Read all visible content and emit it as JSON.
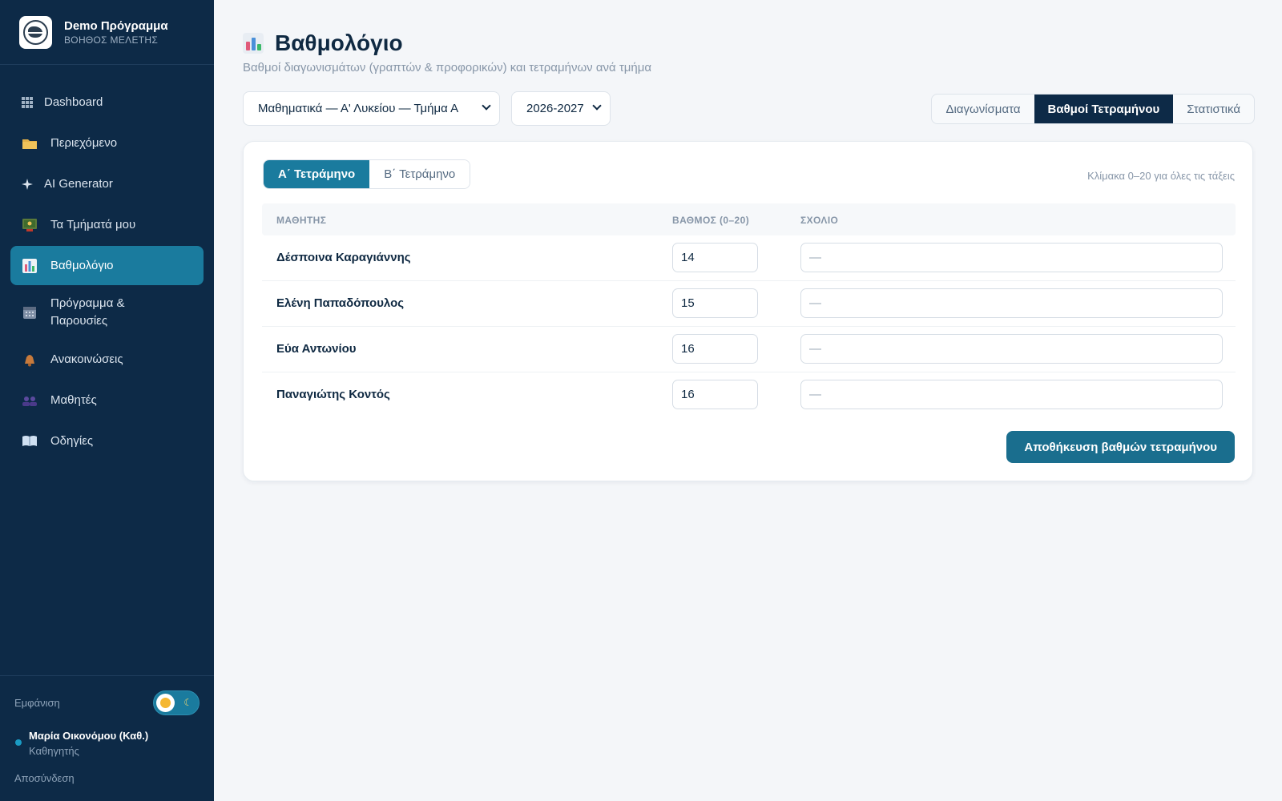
{
  "brand": {
    "title": "Demo Πρόγραμμα",
    "subtitle": "ΒΟΗΘΟΣ ΜΕΛΕΤΗΣ"
  },
  "sidebar": {
    "items": [
      {
        "label": "Dashboard",
        "icon": "grid-icon"
      },
      {
        "label": "Περιεχόμενο",
        "icon": "folder-icon"
      },
      {
        "label": "AI Generator",
        "icon": "sparkle-icon"
      },
      {
        "label": "Τα Τμήματά μου",
        "icon": "classroom-icon"
      },
      {
        "label": "Βαθμολόγιο",
        "icon": "bar-chart-icon",
        "active": true
      },
      {
        "label": "Πρόγραμμα & Παρουσίες",
        "icon": "calendar-icon"
      },
      {
        "label": "Ανακοινώσεις",
        "icon": "bell-icon"
      },
      {
        "label": "Μαθητές",
        "icon": "people-icon"
      },
      {
        "label": "Οδηγίες",
        "icon": "book-icon"
      }
    ],
    "appearance_label": "Εμφάνιση",
    "user": {
      "name": "Μαρία Οικονόμου (Καθ.)",
      "role": "Καθηγητής"
    },
    "logout_label": "Αποσύνδεση"
  },
  "header": {
    "title": "Βαθμολόγιο",
    "subtitle": "Βαθμοί διαγωνισμάτων (γραπτών & προφορικών) και τετραμήνων ανά τμήμα"
  },
  "filters": {
    "class_select": "Μαθηματικά — Α' Λυκείου — Τμήμα Α",
    "year_select": "2026-2027"
  },
  "view_tabs": [
    {
      "label": "Διαγωνίσματα",
      "active": false
    },
    {
      "label": "Βαθμοί Τετραμήνου",
      "active": true
    },
    {
      "label": "Στατιστικά",
      "active": false
    }
  ],
  "card": {
    "term_tabs": [
      {
        "label": "Α΄ Τετράμηνο",
        "active": true
      },
      {
        "label": "Β΄ Τετράμηνο",
        "active": false
      }
    ],
    "scale_note": "Κλίμακα 0–20 για όλες τις τάξεις",
    "columns": {
      "student": "ΜΑΘΗΤΗΣ",
      "grade": "ΒΑΘΜΟΣ (0–20)",
      "comment": "ΣΧΟΛΙΟ"
    },
    "rows": [
      {
        "student": "Δέσποινα Καραγιάννης",
        "grade": "14",
        "comment_placeholder": "—"
      },
      {
        "student": "Ελένη Παπαδόπουλος",
        "grade": "15",
        "comment_placeholder": "—"
      },
      {
        "student": "Εύα Αντωνίου",
        "grade": "16",
        "comment_placeholder": "—"
      },
      {
        "student": "Παναγιώτης Κοντός",
        "grade": "16",
        "comment_placeholder": "—"
      }
    ],
    "save_label": "Αποθήκευση βαθμών τετραμήνου"
  },
  "colors": {
    "sidebar_bg": "#0d2a47",
    "accent": "#1a7b9e",
    "primary_dark": "#0d2a47"
  }
}
